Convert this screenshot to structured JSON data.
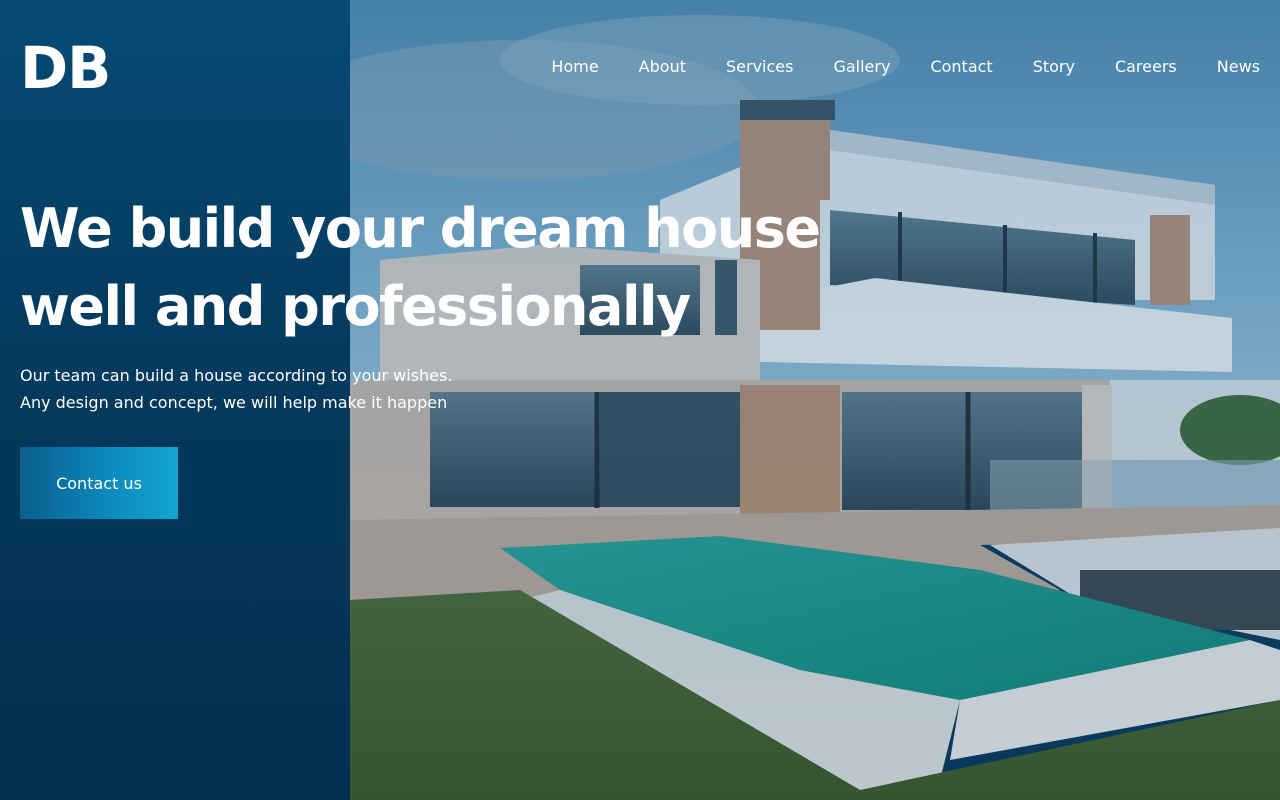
{
  "brand": {
    "logo_text": "DB"
  },
  "nav": {
    "items": [
      {
        "label": "Home"
      },
      {
        "label": "About"
      },
      {
        "label": "Services"
      },
      {
        "label": "Gallery"
      },
      {
        "label": "Contact"
      },
      {
        "label": "Story"
      },
      {
        "label": "Careers"
      },
      {
        "label": "News"
      }
    ]
  },
  "hero": {
    "headline_line1": "We build your dream house",
    "headline_line2": "well and professionally",
    "subtext_line1": "Our team can build a house according to your wishes.",
    "subtext_line2": "Any design and concept, we will help make it happen",
    "cta_label": "Contact us",
    "background_image": "modern-house-with-pool-photo"
  },
  "colors": {
    "left_panel": "#043a5e",
    "cta_start": "#0a5f8e",
    "cta_end": "#11a6d3",
    "text": "#ffffff"
  }
}
